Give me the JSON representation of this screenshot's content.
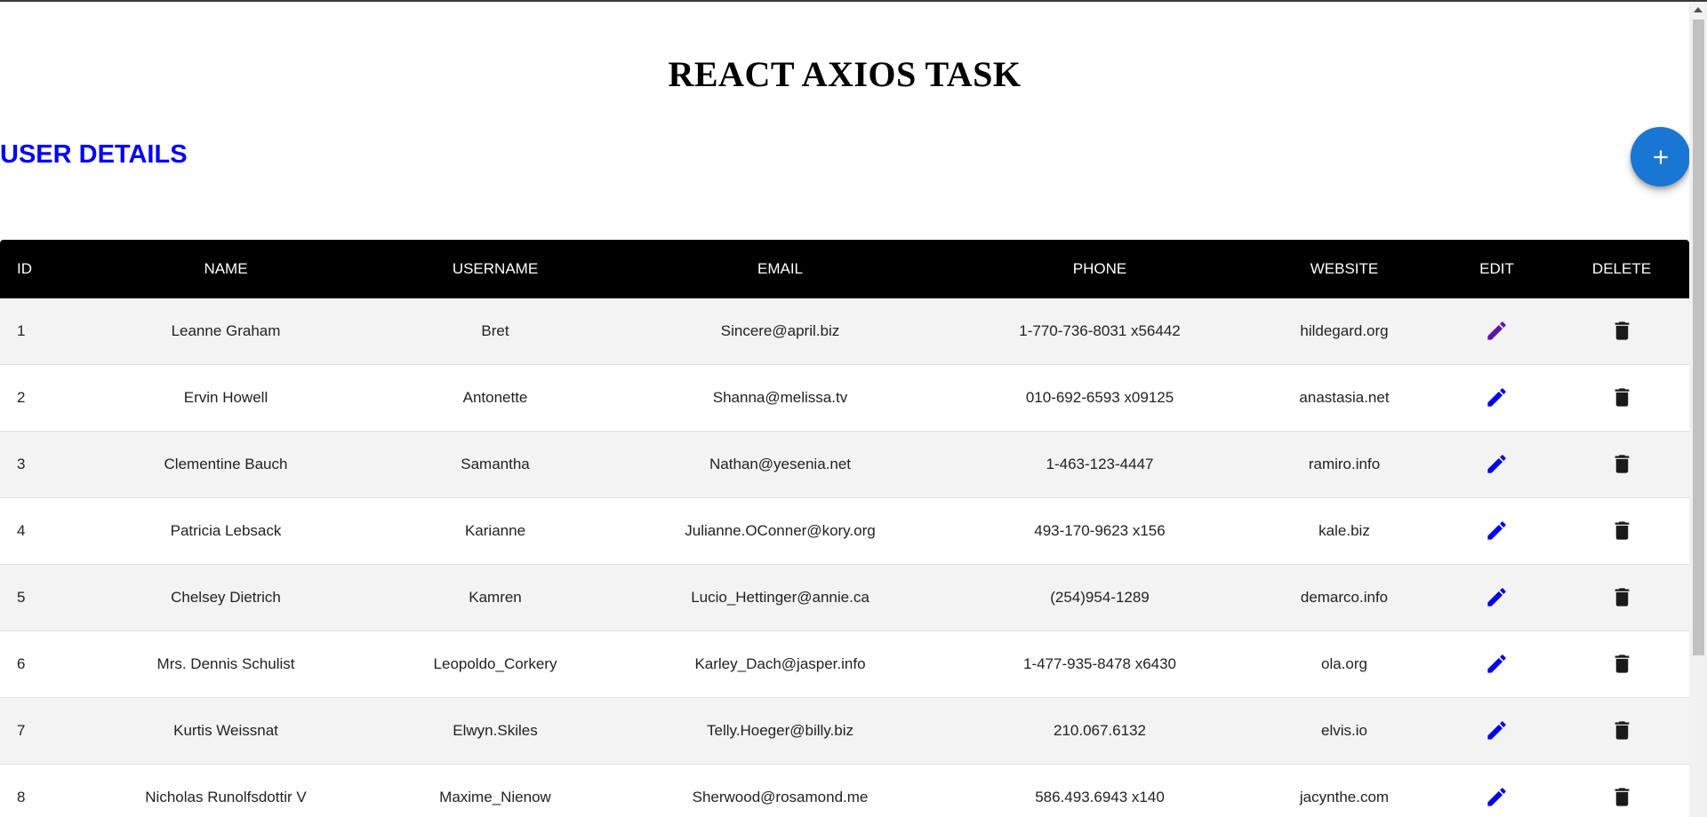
{
  "page": {
    "title": "REACT AXIOS TASK",
    "section_title": "USER DETAILS"
  },
  "fab": {
    "icon": "plus-icon",
    "color": "#1976d2"
  },
  "table": {
    "headers": [
      "ID",
      "NAME",
      "USERNAME",
      "EMAIL",
      "PHONE",
      "WEBSITE",
      "EDIT",
      "DELETE"
    ],
    "rows": [
      {
        "id": "1",
        "name": "Leanne Graham",
        "username": "Bret",
        "email": "Sincere@april.biz",
        "phone": "1-770-736-8031 x56442",
        "website": "hildegard.org",
        "edit_color": "#5b14a8"
      },
      {
        "id": "2",
        "name": "Ervin Howell",
        "username": "Antonette",
        "email": "Shanna@melissa.tv",
        "phone": "010-692-6593 x09125",
        "website": "anastasia.net",
        "edit_color": "#0000ee"
      },
      {
        "id": "3",
        "name": "Clementine Bauch",
        "username": "Samantha",
        "email": "Nathan@yesenia.net",
        "phone": "1-463-123-4447",
        "website": "ramiro.info",
        "edit_color": "#0000ee"
      },
      {
        "id": "4",
        "name": "Patricia Lebsack",
        "username": "Karianne",
        "email": "Julianne.OConner@kory.org",
        "phone": "493-170-9623 x156",
        "website": "kale.biz",
        "edit_color": "#0000ee"
      },
      {
        "id": "5",
        "name": "Chelsey Dietrich",
        "username": "Kamren",
        "email": "Lucio_Hettinger@annie.ca",
        "phone": "(254)954-1289",
        "website": "demarco.info",
        "edit_color": "#0000ee"
      },
      {
        "id": "6",
        "name": "Mrs. Dennis Schulist",
        "username": "Leopoldo_Corkery",
        "email": "Karley_Dach@jasper.info",
        "phone": "1-477-935-8478 x6430",
        "website": "ola.org",
        "edit_color": "#0000ee"
      },
      {
        "id": "7",
        "name": "Kurtis Weissnat",
        "username": "Elwyn.Skiles",
        "email": "Telly.Hoeger@billy.biz",
        "phone": "210.067.6132",
        "website": "elvis.io",
        "edit_color": "#0000ee"
      },
      {
        "id": "8",
        "name": "Nicholas Runolfsdottir V",
        "username": "Maxime_Nienow",
        "email": "Sherwood@rosamond.me",
        "phone": "586.493.6943 x140",
        "website": "jacynthe.com",
        "edit_color": "#0000ee"
      }
    ]
  },
  "icons": {
    "edit": "pencil-icon",
    "delete": "trash-icon"
  },
  "colors": {
    "section_title": "#0000ff",
    "header_bg": "#000000",
    "row_alt": "#f3f3f3",
    "delete_icon": "#1a1a1a"
  }
}
